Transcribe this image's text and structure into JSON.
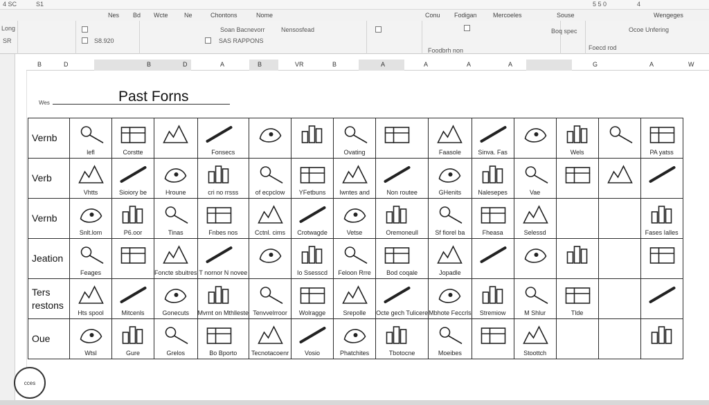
{
  "titlebar": {
    "left_a": "4 SC",
    "left_b": "S1",
    "right_a": "5 5 0",
    "right_b": "4"
  },
  "tabs": [
    "Nes",
    "Bd",
    "Wcte",
    "Ne",
    "Chontons",
    "Nome",
    "Conu",
    "Fodigan",
    "Mercoeles",
    "Souse",
    "Wengeges"
  ],
  "ribbon": {
    "left": [
      "Long",
      "SR"
    ],
    "items": [
      "Soan Bacnevorr",
      "Nensosfead",
      "SAS RAPPONS",
      "S8.920",
      "Foodbrh non",
      "Boq spec",
      "Ocoe Unfering",
      "Foecd rod"
    ]
  },
  "columns": [
    "B",
    "D",
    "B",
    "D",
    "A",
    "B",
    "VR",
    "B",
    "A",
    "A",
    "A",
    "A",
    "G",
    "A",
    "W"
  ],
  "document": {
    "title": "Past Forns",
    "side_label": "Wes"
  },
  "row_labels": [
    "Vernb",
    "Verb",
    "Vernb",
    "Jeation",
    "Ters restons",
    "Oue"
  ],
  "cells": [
    [
      "lefl",
      "Corstte",
      "",
      "Fonsecs",
      "",
      "",
      "Ovating",
      "",
      "Faasole",
      "Sinva. Fas",
      "",
      "Wels",
      "",
      "PA yatss"
    ],
    [
      "Vhtts",
      "Sioiory be",
      "Hroune",
      "cri no rrsss",
      "of ecpclow",
      "YFetbuns",
      "Iwntes and",
      "Non routee",
      "GHenits",
      "Nalesepes",
      "Vae",
      "",
      "",
      ""
    ],
    [
      "Snlt.lom",
      "P6.oor",
      "Tinas",
      "Fnbes nos",
      "Cctnl. cims",
      "Crotwagde",
      "Vetse",
      "Oremoneull",
      "Sf fiorel ba",
      "Fheasa",
      "Selessd",
      "",
      "",
      "Fases Ialles"
    ],
    [
      "Feages",
      "",
      "Foncte sbuitres",
      "T nornor N novee",
      "",
      "Io Ssesscd",
      "Feloon Rrre",
      "Bod coqale",
      "Jopadle",
      "",
      "",
      "",
      "",
      ""
    ],
    [
      "Hts spool",
      "Mitcenls",
      "Gonecuts",
      "Mvrnt on Mthlleste",
      "Tenvvelrroor",
      "Wolragge",
      "Srepolle",
      "Octe gech Tulicere",
      "Mbhote Feccrls",
      "Stremiow",
      "M Shlur",
      "Tlde",
      "",
      ""
    ],
    [
      "Wtsl",
      "Gure",
      "Grelos",
      "Bo Bporto",
      "Tecnotacoenr",
      "Vosio",
      "Phatchites",
      "Tbotocne",
      "Moeibes",
      "",
      "Stoottch",
      "",
      "",
      ""
    ]
  ],
  "icons": [
    [
      "magnifier-icon",
      "brush-icon",
      "bar-icon",
      "hand-pointer-icon",
      "city-icon",
      "buildings-icon",
      "clock-icon",
      "skyline-icon",
      "hat-icon",
      "ball-icon",
      "boot-icon",
      "window-icon",
      "city-icon",
      "sun-icon"
    ],
    [
      "pencil-icon",
      "cathedral-icon",
      "map-icon",
      "book-icon",
      "plane-icon",
      "tree-icon",
      "pen-icon",
      "street-icon",
      "lamp-icon",
      "hands-icon",
      "factory-icon",
      "truck-icon",
      "pen-icon",
      "machine-icon"
    ],
    [
      "calendar-icon",
      "sparkle-icon",
      "boat-icon",
      "pot-icon",
      "document-icon",
      "wrench-icon",
      "clipboard-icon",
      "bridge-icon",
      "dog-icon",
      "landscape-icon",
      "ruler-icon",
      "",
      "",
      "screen-icon"
    ],
    [
      "scene-icon",
      "bird-icon",
      "barn-icon",
      "shelf-icon",
      "book-open-icon",
      "saw-icon",
      "line-icon",
      "sign-icon",
      "tv-icon",
      "hand-icon",
      "hand-drawing-icon",
      "cutter-icon",
      "",
      "house-icon"
    ],
    [
      "hand-wave-icon",
      "tools-icon",
      "arrow-icon",
      "newspaper-icon",
      "window-icon",
      "keyboard-icon",
      "village-icon",
      "hat-icon",
      "pitcher-icon",
      "jug-icon",
      "hand-bowl-icon",
      "tower-icon",
      "",
      "curve-icon"
    ],
    [
      "feather-icon",
      "scissors-icon",
      "spray-icon",
      "hand-tool-icon",
      "plane-icon",
      "chair-icon",
      "stroke-icon",
      "hand-holding-icon",
      "crate-icon",
      "town-icon",
      "crowd-icon",
      "",
      "",
      "building-icon"
    ]
  ],
  "footer_badge": "cces"
}
